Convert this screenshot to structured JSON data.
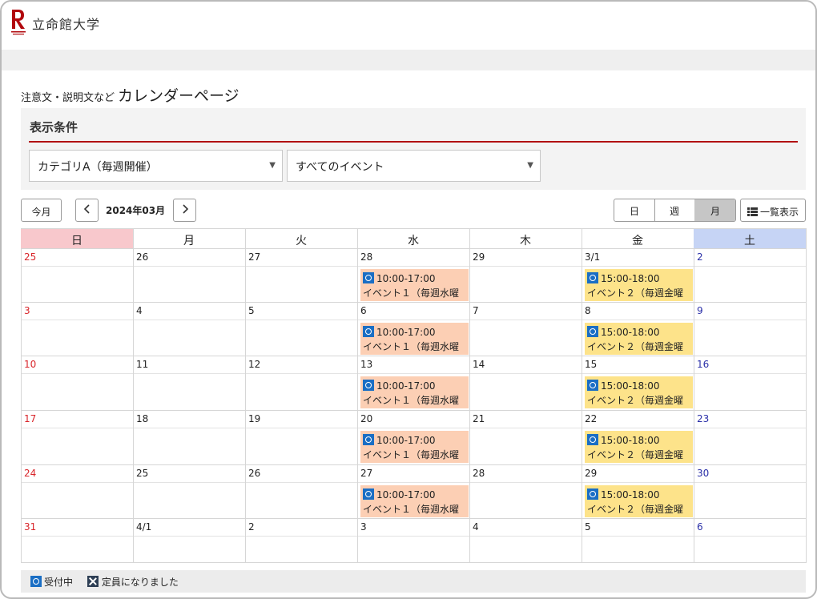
{
  "header": {
    "logo_letter": "R",
    "logo_text": "立命館大学"
  },
  "page": {
    "title_small": "注意文・説明文など",
    "title_big": "カレンダーページ"
  },
  "conditions": {
    "title": "表示条件",
    "category_value": "カテゴリA（毎週開催）",
    "event_value": "すべてのイベント"
  },
  "toolbar": {
    "today_label": "今月",
    "prev_icon": "chevron-left-icon",
    "next_icon": "chevron-right-icon",
    "month_label": "2024年03月",
    "view_day": "日",
    "view_week": "週",
    "view_month": "月",
    "view_selected": "月",
    "list_label": "一覧表示"
  },
  "calendar": {
    "weekdays": [
      "日",
      "月",
      "火",
      "水",
      "木",
      "金",
      "土"
    ],
    "weeks": [
      [
        "25",
        "26",
        "27",
        "28",
        "29",
        "3/1",
        "2"
      ],
      [
        "3",
        "4",
        "5",
        "6",
        "7",
        "8",
        "9"
      ],
      [
        "10",
        "11",
        "12",
        "13",
        "14",
        "15",
        "16"
      ],
      [
        "17",
        "18",
        "19",
        "20",
        "21",
        "22",
        "23"
      ],
      [
        "24",
        "25",
        "26",
        "27",
        "28",
        "29",
        "30"
      ],
      [
        "31",
        "4/1",
        "2",
        "3",
        "4",
        "5",
        "6"
      ]
    ],
    "event_wed": {
      "time": "10:00-17:00",
      "title": "イベント１（毎週水曜"
    },
    "event_fri": {
      "time": "15:00-18:00",
      "title": "イベント２（毎週金曜"
    }
  },
  "legend": {
    "open_label": "受付中",
    "full_label": "定員になりました"
  },
  "colors": {
    "accent_red": "#b1080d",
    "sunday_header": "#f8c8cc",
    "saturday_header": "#c6d4f5",
    "wed_event": "#fccfb4",
    "fri_event": "#fde38a",
    "status_blue": "#1a6ec4"
  }
}
